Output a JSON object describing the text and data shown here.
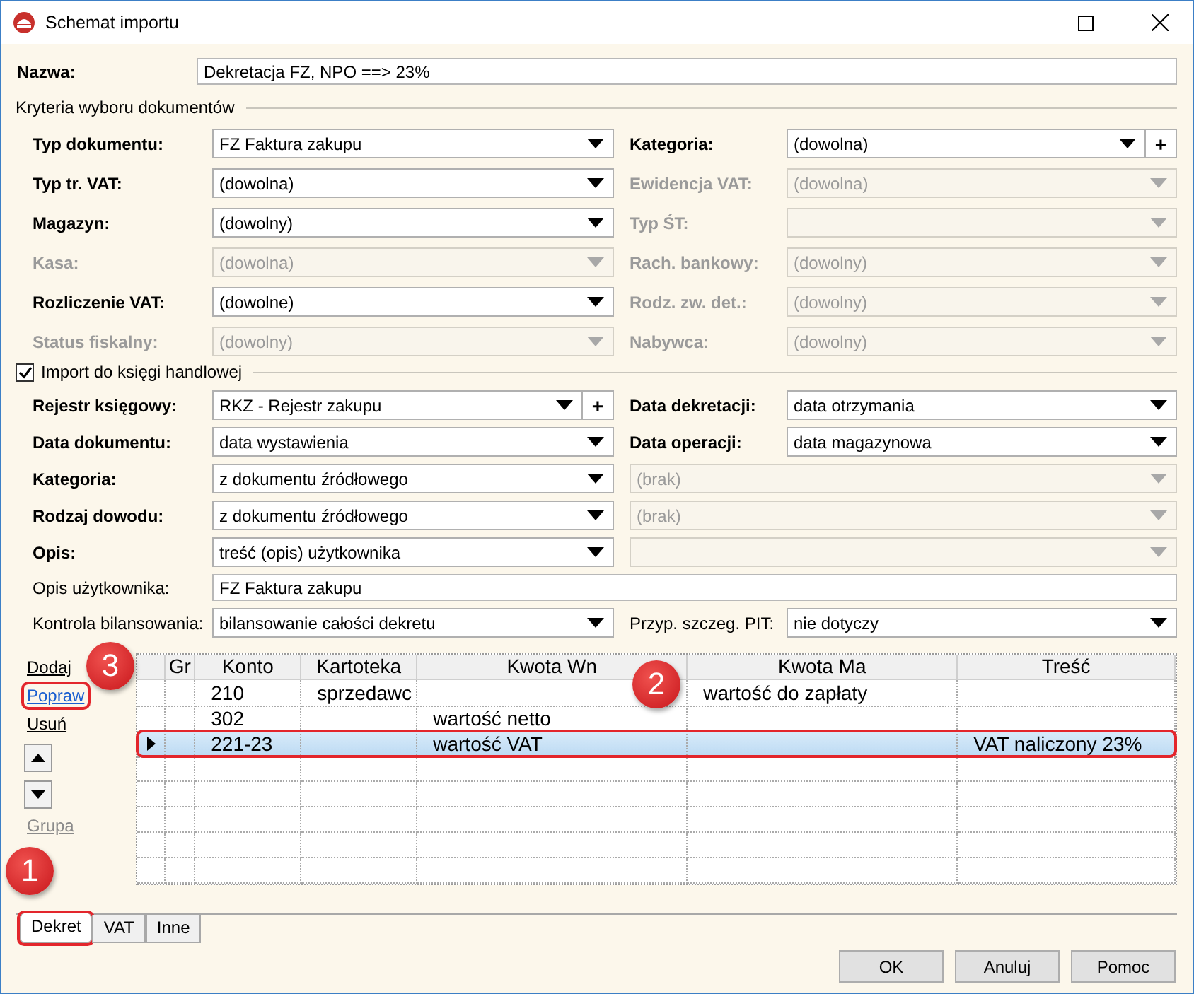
{
  "window": {
    "title": "Schemat importu"
  },
  "name_field": {
    "label": "Nazwa:",
    "value": "Dekretacja FZ, NPO ==> 23%"
  },
  "criteria": {
    "title": "Kryteria wyboru dokumentów",
    "fields": [
      {
        "label": "Typ dokumentu:",
        "value": "FZ Faktura zakupu",
        "kind": "dropdown",
        "bold": true,
        "disabled": false
      },
      {
        "label": "Kategoria:",
        "value": "(dowolna)",
        "kind": "dropdown",
        "bold": true,
        "disabled": false,
        "add": "+"
      },
      {
        "label": "Typ tr. VAT:",
        "value": "(dowolna)",
        "kind": "dropdown",
        "bold": true,
        "disabled": false
      },
      {
        "label": "Ewidencja VAT:",
        "value": "(dowolna)",
        "kind": "dropdown",
        "bold": true,
        "disabled": true
      },
      {
        "label": "Magazyn:",
        "value": "(dowolny)",
        "kind": "dropdown",
        "bold": true,
        "disabled": false
      },
      {
        "label": "Typ ŚT:",
        "kind": "dropdown",
        "bold": true,
        "disabled": true
      },
      {
        "label": "Kasa:",
        "value": "(dowolna)",
        "kind": "dropdown",
        "bold": true,
        "disabled": true
      },
      {
        "label": "Rach. bankowy:",
        "value": "(dowolny)",
        "kind": "dropdown",
        "bold": true,
        "disabled": true
      },
      {
        "label": "Rozliczenie VAT:",
        "value": "(dowolne)",
        "kind": "dropdown",
        "bold": true,
        "disabled": false
      },
      {
        "label": "Rodz. zw. det.:",
        "value": "(dowolny)",
        "kind": "dropdown",
        "bold": true,
        "disabled": true
      },
      {
        "label": "Status fiskalny:",
        "value": "(dowolny)",
        "kind": "dropdown",
        "bold": true,
        "disabled": true
      },
      {
        "label": "Nabywca:",
        "value": "(dowolny)",
        "kind": "dropdown",
        "bold": true,
        "disabled": true
      }
    ]
  },
  "import": {
    "title": "Import do księgi handlowej",
    "checked": true,
    "fields": [
      {
        "label": "Rejestr księgowy:",
        "value": "RKZ - Rejestr zakupu",
        "kind": "dropdown",
        "bold": true,
        "disabled": false,
        "add": "+"
      },
      {
        "label": "Data dekretacji:",
        "value": "data otrzymania",
        "kind": "dropdown",
        "bold": true,
        "disabled": false
      },
      {
        "label": "Data dokumentu:",
        "value": "data wystawienia",
        "kind": "dropdown",
        "bold": true,
        "disabled": false
      },
      {
        "label": "Data operacji:",
        "value": "data magazynowa",
        "kind": "dropdown",
        "bold": true,
        "disabled": false
      },
      {
        "label": "Kategoria:",
        "value": "z dokumentu źródłowego",
        "kind": "dropdown",
        "bold": true,
        "disabled": false
      },
      {
        "value": "(brak)",
        "kind": "dropdown",
        "disabled": true
      },
      {
        "label": "Rodzaj dowodu:",
        "value": "z dokumentu źródłowego",
        "kind": "dropdown",
        "bold": true,
        "disabled": false
      },
      {
        "value": "(brak)",
        "kind": "dropdown",
        "disabled": true
      },
      {
        "label": "Opis:",
        "value": "treść (opis) użytkownika",
        "kind": "dropdown",
        "bold": true,
        "disabled": false
      },
      {
        "kind": "dropdown",
        "disabled": true
      },
      {
        "label": "Opis użytkownika:",
        "value": "FZ Faktura zakupu",
        "kind": "text",
        "bold": false
      },
      {
        "label": "Kontrola bilansowania:",
        "value": "bilansowanie całości dekretu",
        "kind": "dropdown",
        "bold": false,
        "disabled": false
      },
      {
        "label": "Przyp. szczeg. PIT:",
        "value": "nie dotyczy",
        "kind": "dropdown",
        "bold": false,
        "disabled": false
      }
    ]
  },
  "actions": [
    {
      "label": "Dodaj",
      "kind": "link",
      "disabled": false,
      "highlighted": false
    },
    {
      "label": "Popraw",
      "kind": "link",
      "disabled": false,
      "highlighted": true
    },
    {
      "label": "Usuń",
      "kind": "link",
      "disabled": false,
      "highlighted": false
    },
    {
      "kind": "up"
    },
    {
      "kind": "down"
    },
    {
      "label": "Grupa",
      "kind": "link",
      "disabled": true,
      "highlighted": false
    }
  ],
  "table": {
    "columns": [
      "Gr",
      "Konto",
      "Kartoteka",
      "Kwota Wn",
      "Kwota Ma",
      "Treść"
    ],
    "rows": [
      {
        "cells": [
          "",
          "210",
          "sprzedawc",
          "",
          "wartość do zapłaty",
          ""
        ],
        "selected": false,
        "highlighted": false
      },
      {
        "cells": [
          "",
          "302",
          "",
          "wartość netto",
          "",
          ""
        ],
        "selected": false,
        "highlighted": false
      },
      {
        "cells": [
          "",
          "221-23",
          "",
          "wartość VAT",
          "",
          "VAT naliczony 23%"
        ],
        "selected": true,
        "highlighted": true
      }
    ]
  },
  "tabs": [
    {
      "label": "Dekret",
      "selected": true,
      "highlighted": true
    },
    {
      "label": "VAT",
      "selected": false,
      "highlighted": false
    },
    {
      "label": "Inne",
      "selected": false,
      "highlighted": false
    }
  ],
  "buttons": [
    "OK",
    "Anuluj",
    "Pomoc"
  ],
  "callouts": [
    {
      "label": "1"
    },
    {
      "label": "2"
    },
    {
      "label": "3"
    }
  ]
}
